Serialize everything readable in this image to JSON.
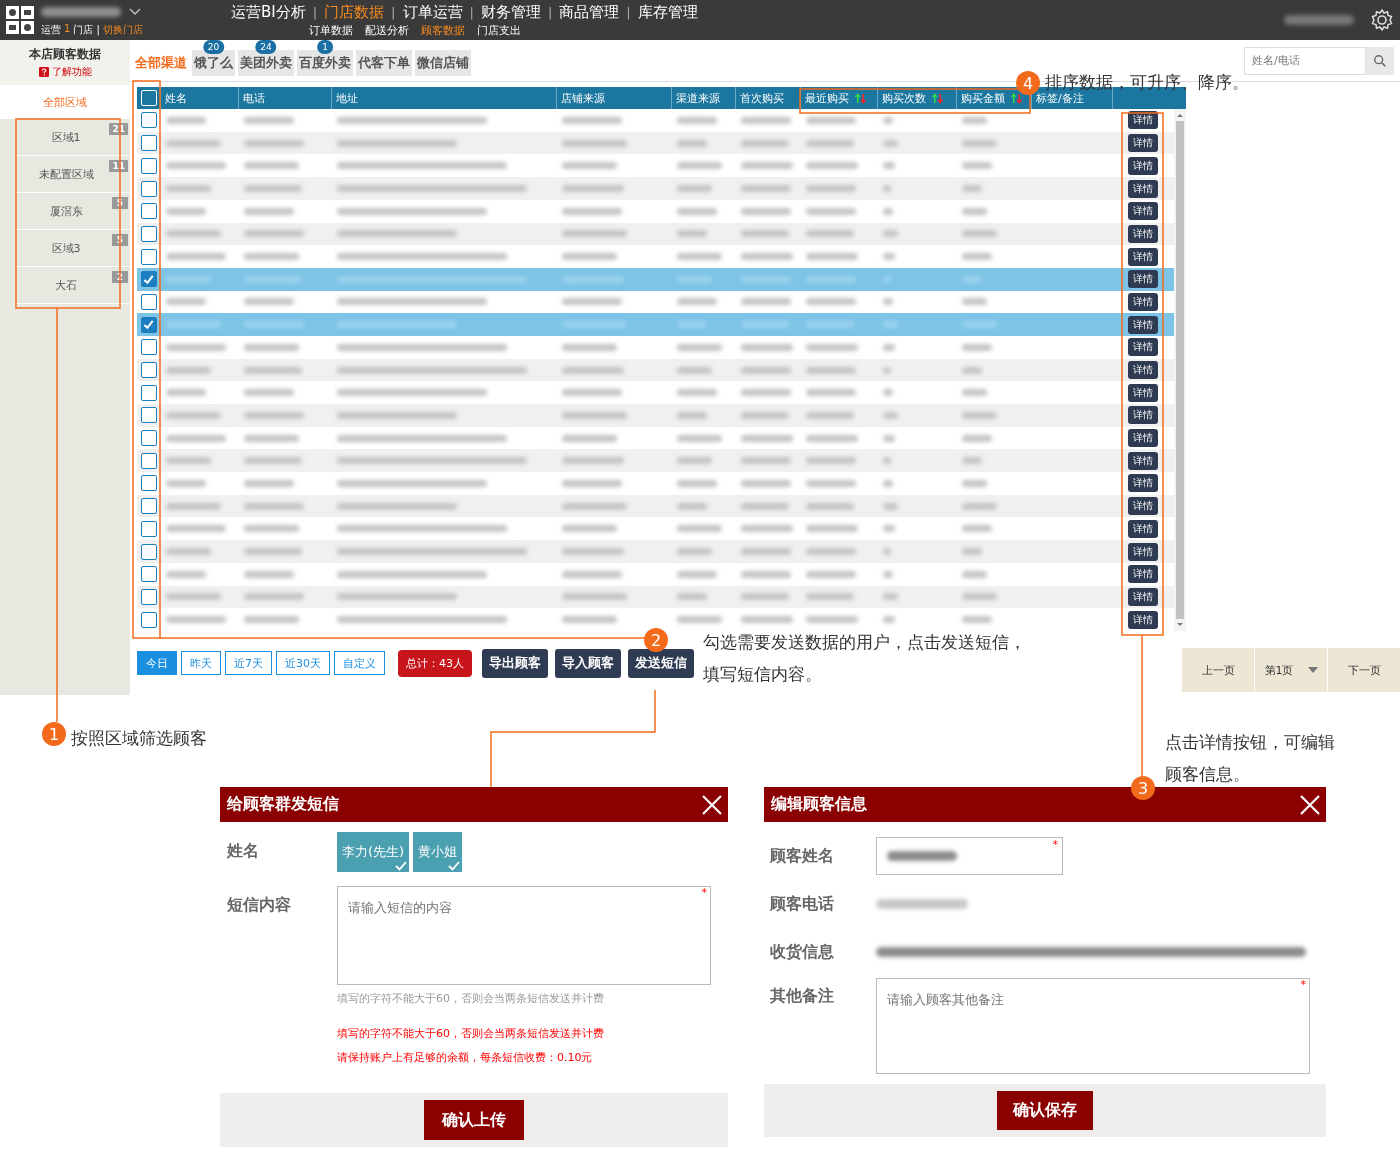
{
  "header": {
    "store_line": {
      "role": "运营",
      "count": "1",
      "unit": "门店 |",
      "link": "切换门店"
    },
    "nav": [
      {
        "label": "运营BI分析",
        "selected": false
      },
      {
        "separator": "|",
        "label": "门店数据",
        "selected": true
      },
      {
        "separator": "|",
        "label": "订单运营",
        "selected": false
      },
      {
        "separator": "|",
        "label": "财务管理",
        "selected": false
      },
      {
        "separator": "|",
        "label": "商品管理",
        "selected": false
      },
      {
        "separator": "|",
        "label": "库存管理",
        "selected": false
      }
    ],
    "subnav": [
      {
        "label": "订单数据",
        "selected": false
      },
      {
        "label": "配送分析",
        "selected": false
      },
      {
        "label": "顾客数据",
        "selected": true
      },
      {
        "label": "门店支出",
        "selected": false
      }
    ]
  },
  "sidebar": {
    "title": "本店顾客数据",
    "help": "了解功能",
    "all": {
      "label": "全部区域",
      "selected": true
    },
    "regions": [
      {
        "name": "区域1",
        "count": "21"
      },
      {
        "name": "未配置区域",
        "count": "11"
      },
      {
        "name": "厦滘东",
        "count": "5"
      },
      {
        "name": "区域3",
        "count": "5"
      },
      {
        "name": "大石",
        "count": "2"
      }
    ]
  },
  "channels": [
    {
      "label": "全部渠道",
      "selected": true
    },
    {
      "label": "饿了么",
      "badge": "20",
      "selected": false
    },
    {
      "label": "美团外卖",
      "badge": "24",
      "selected": false
    },
    {
      "label": "百度外卖",
      "badge": "1",
      "selected": false
    },
    {
      "label": "代客下单",
      "selected": false
    },
    {
      "label": "微信店铺",
      "selected": false
    }
  ],
  "search": {
    "placeholder": "姓名/电话"
  },
  "table": {
    "select_all": {
      "checked": false
    },
    "columns": [
      {
        "label": "姓名",
        "sortable": false
      },
      {
        "label": "电话",
        "sortable": false
      },
      {
        "label": "地址",
        "sortable": false
      },
      {
        "label": "店铺来源",
        "sortable": false
      },
      {
        "label": "渠道来源",
        "sortable": false
      },
      {
        "label": "首次购买",
        "sortable": false
      },
      {
        "label": "最近购买",
        "sortable": true
      },
      {
        "label": "购买次数",
        "sortable": true
      },
      {
        "label": "购买金额",
        "sortable": true
      },
      {
        "label": "标签/备注",
        "sortable": false
      }
    ],
    "rows": [
      {
        "selected": false,
        "action": "详情"
      },
      {
        "selected": false,
        "action": "详情"
      },
      {
        "selected": false,
        "action": "详情"
      },
      {
        "selected": false,
        "action": "详情"
      },
      {
        "selected": false,
        "action": "详情"
      },
      {
        "selected": false,
        "action": "详情"
      },
      {
        "selected": false,
        "action": "详情"
      },
      {
        "selected": true,
        "action": "详情"
      },
      {
        "selected": false,
        "action": "详情"
      },
      {
        "selected": true,
        "action": "详情"
      },
      {
        "selected": false,
        "action": "详情"
      },
      {
        "selected": false,
        "action": "详情"
      },
      {
        "selected": false,
        "action": "详情"
      },
      {
        "selected": false,
        "action": "详情"
      },
      {
        "selected": false,
        "action": "详情"
      },
      {
        "selected": false,
        "action": "详情"
      },
      {
        "selected": false,
        "action": "详情"
      },
      {
        "selected": false,
        "action": "详情"
      },
      {
        "selected": false,
        "action": "详情"
      },
      {
        "selected": false,
        "action": "详情"
      },
      {
        "selected": false,
        "action": "详情"
      },
      {
        "selected": false,
        "action": "详情"
      },
      {
        "selected": false,
        "action": "详情"
      }
    ]
  },
  "footer": {
    "date_filters": [
      {
        "label": "今日",
        "selected": true
      },
      {
        "label": "昨天",
        "selected": false
      },
      {
        "label": "近7天",
        "selected": false
      },
      {
        "label": "近30天",
        "selected": false
      },
      {
        "label": "自定义",
        "selected": false
      }
    ],
    "total": "总计：43人",
    "buttons": [
      "导出顾客",
      "导入顾客",
      "发送短信"
    ]
  },
  "pager": {
    "prev": "上一页",
    "page": "第1页",
    "next": "下一页"
  },
  "annotations": [
    {
      "number": "1",
      "lines": [
        "按照区域筛选顾客"
      ]
    },
    {
      "number": "2",
      "lines": [
        "勾选需要发送数据的用户，点击发送短信，",
        "填写短信内容。"
      ]
    },
    {
      "number": "3",
      "lines": [
        "点击详情按钮，可编辑",
        "顾客信息。"
      ]
    },
    {
      "number": "4",
      "lines": [
        "排序数据，可升序、降序。"
      ]
    }
  ],
  "sms_dialog": {
    "title": "给顾客群发短信",
    "name_label": "姓名",
    "recipients": [
      {
        "name": "李力(先生)",
        "checked": true
      },
      {
        "name": "黄小姐",
        "checked": true
      }
    ],
    "content_label": "短信内容",
    "required_mark": "*",
    "placeholder": "请输入短信的内容",
    "hint": "填写的字符不能大于60，否则会当两条短信发送并计费",
    "warnings": [
      "填写的字符不能大于60，否则会当两条短信发送并计费",
      "请保持账户上有足够的余额，每条短信收费：0.10元"
    ],
    "submit": "确认上传"
  },
  "edit_dialog": {
    "title": "编辑顾客信息",
    "name_label": "顾客姓名",
    "name_required_mark": "*",
    "phone_label": "顾客电话",
    "address_label": "收货信息",
    "remark_label": "其他备注",
    "remark_placeholder": "请输入顾客其他备注",
    "remark_required_mark": "*",
    "submit": "确认保存"
  }
}
